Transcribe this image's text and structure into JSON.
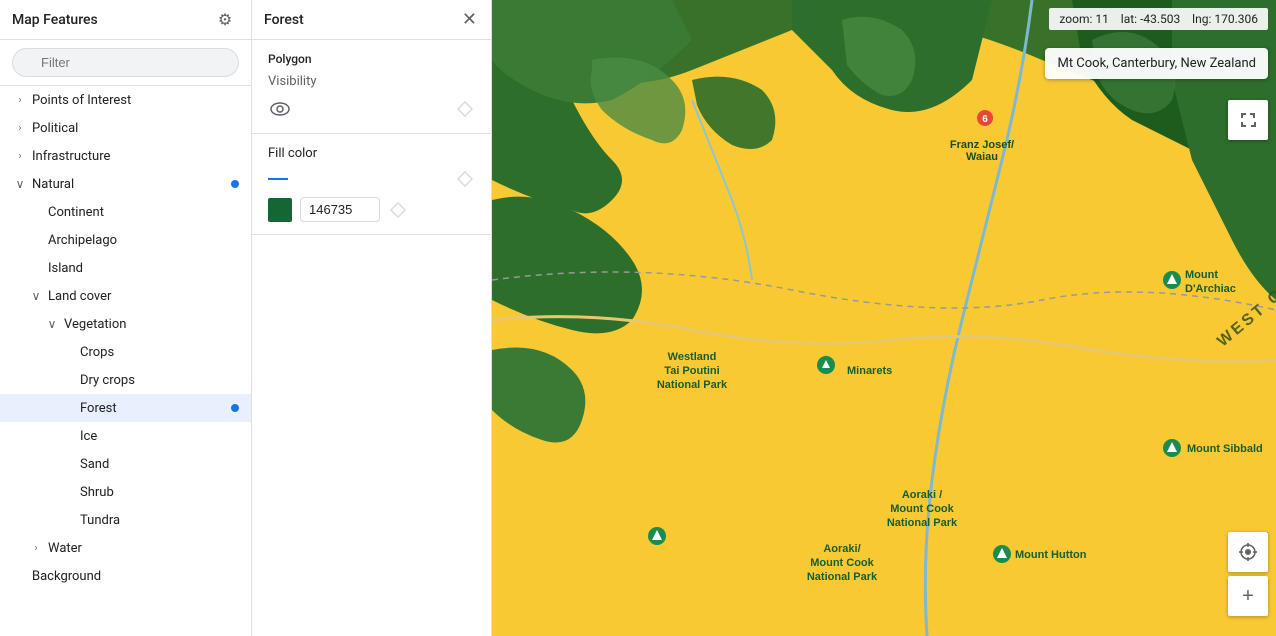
{
  "sidebar": {
    "title": "Map Features",
    "filter_placeholder": "Filter",
    "items": [
      {
        "id": "points-of-interest",
        "label": "Points of Interest",
        "level": 1,
        "has_chevron": true,
        "chevron": "›",
        "active": false,
        "dot": false
      },
      {
        "id": "political",
        "label": "Political",
        "level": 1,
        "has_chevron": true,
        "chevron": "›",
        "active": false,
        "dot": false
      },
      {
        "id": "infrastructure",
        "label": "Infrastructure",
        "level": 1,
        "has_chevron": true,
        "chevron": "›",
        "active": false,
        "dot": false
      },
      {
        "id": "natural",
        "label": "Natural",
        "level": 1,
        "has_chevron": true,
        "chevron": "∨",
        "active": false,
        "dot": true
      },
      {
        "id": "continent",
        "label": "Continent",
        "level": 2,
        "has_chevron": false,
        "active": false,
        "dot": false
      },
      {
        "id": "archipelago",
        "label": "Archipelago",
        "level": 2,
        "has_chevron": false,
        "active": false,
        "dot": false
      },
      {
        "id": "island",
        "label": "Island",
        "level": 2,
        "has_chevron": false,
        "active": false,
        "dot": false
      },
      {
        "id": "land-cover",
        "label": "Land cover",
        "level": 2,
        "has_chevron": true,
        "chevron": "∨",
        "active": false,
        "dot": false
      },
      {
        "id": "vegetation",
        "label": "Vegetation",
        "level": 3,
        "has_chevron": true,
        "chevron": "∨",
        "active": false,
        "dot": false
      },
      {
        "id": "crops",
        "label": "Crops",
        "level": 4,
        "has_chevron": false,
        "active": false,
        "dot": false
      },
      {
        "id": "dry-crops",
        "label": "Dry crops",
        "level": 4,
        "has_chevron": false,
        "active": false,
        "dot": false
      },
      {
        "id": "forest",
        "label": "Forest",
        "level": 4,
        "has_chevron": false,
        "active": true,
        "dot": true
      },
      {
        "id": "ice",
        "label": "Ice",
        "level": 4,
        "has_chevron": false,
        "active": false,
        "dot": false
      },
      {
        "id": "sand",
        "label": "Sand",
        "level": 4,
        "has_chevron": false,
        "active": false,
        "dot": false
      },
      {
        "id": "shrub",
        "label": "Shrub",
        "level": 4,
        "has_chevron": false,
        "active": false,
        "dot": false
      },
      {
        "id": "tundra",
        "label": "Tundra",
        "level": 4,
        "has_chevron": false,
        "active": false,
        "dot": false
      },
      {
        "id": "water",
        "label": "Water",
        "level": 2,
        "has_chevron": true,
        "chevron": "›",
        "active": false,
        "dot": false
      },
      {
        "id": "background",
        "label": "Background",
        "level": 1,
        "has_chevron": false,
        "active": false,
        "dot": false
      }
    ]
  },
  "detail": {
    "title": "Forest",
    "polygon_label": "Polygon",
    "visibility_label": "Visibility",
    "fill_color_label": "Fill color",
    "color_hex": "146735",
    "color_swatch": "#146735"
  },
  "map": {
    "zoom_label": "zoom:",
    "zoom_value": "11",
    "lat_label": "lat:",
    "lat_value": "-43.503",
    "lng_label": "lng:",
    "lng_value": "170.306",
    "location_name": "Mt Cook, Canterbury, New Zealand"
  },
  "icons": {
    "gear": "⚙",
    "close": "✕",
    "filter": "≡",
    "eye": "👁",
    "diamond": "◇",
    "location": "⊕",
    "plus": "+",
    "expand": "⛶"
  }
}
